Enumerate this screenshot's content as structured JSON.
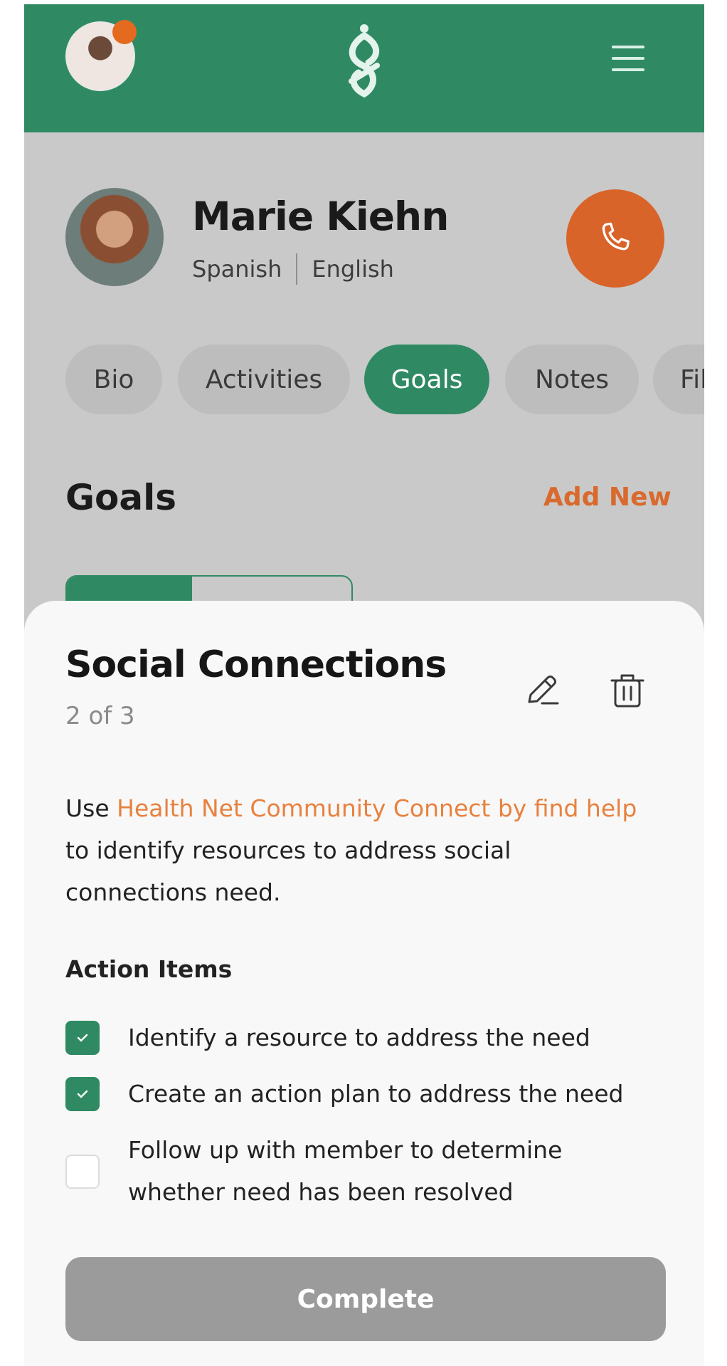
{
  "header": {
    "avatar_icon": "user-avatar-icon",
    "notification_icon": "notification-dot-icon",
    "logo_icon": "app-logo-icon",
    "menu_icon": "hamburger-menu-icon",
    "brand_color": "#2f8a63"
  },
  "profile": {
    "name": "Marie Kiehn",
    "languages": [
      "Spanish",
      "English"
    ],
    "call_icon": "phone-icon",
    "call_color": "#d9642a"
  },
  "tabs": [
    {
      "label": "Bio",
      "active": false
    },
    {
      "label": "Activities",
      "active": false
    },
    {
      "label": "Goals",
      "active": true
    },
    {
      "label": "Notes",
      "active": false
    },
    {
      "label": "Fil",
      "active": false
    }
  ],
  "goals": {
    "title": "Goals",
    "add_new": "Add New"
  },
  "sheet": {
    "title": "Social Connections",
    "progress": "2 of 3",
    "edit_icon": "pencil-icon",
    "delete_icon": "trash-icon",
    "description_pre": "Use ",
    "description_link": "Health Net Community Connect by find help",
    "description_post": " to identify resources to address social connections need.",
    "action_heading": "Action Items",
    "action_items": [
      {
        "label": "Identify a resource to address the need",
        "checked": true
      },
      {
        "label": "Create an action plan to address the need",
        "checked": true
      },
      {
        "label": "Follow up with member to determine whether need has been resolved",
        "checked": false
      }
    ],
    "complete_label": "Complete",
    "accent_color": "#e8813e"
  }
}
